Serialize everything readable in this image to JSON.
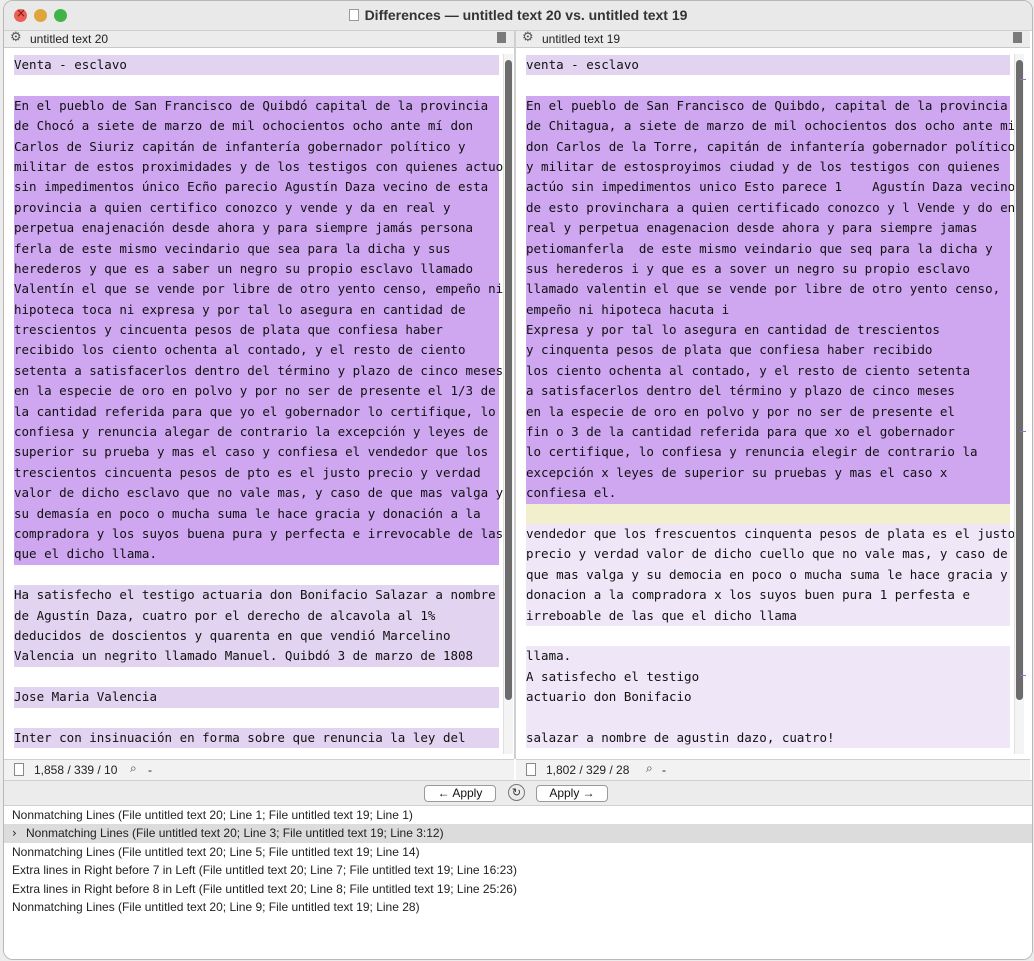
{
  "window": {
    "title": "Differences — untitled text 20 vs. untitled text 19"
  },
  "left": {
    "name": "untitled text 20",
    "status": "1,858 / 339 / 10",
    "search": "-",
    "lines": [
      {
        "t": "Venta - esclavo",
        "c": "l"
      },
      {
        "t": "",
        "c": ""
      },
      {
        "t": "En el pueblo de San Francisco de Quibdó capital de la provincia",
        "c": "p"
      },
      {
        "t": "de Chocó a siete de marzo de mil ochocientos ocho ante mí don",
        "c": "p"
      },
      {
        "t": "Carlos de Siuriz capitán de infantería gobernador político y",
        "c": "p"
      },
      {
        "t": "militar de estos proximidades y de los testigos con quienes actuo",
        "c": "p"
      },
      {
        "t": "sin impedimentos único Eсño parecio Agustín Daza vecino de esta",
        "c": "p"
      },
      {
        "t": "provincia a quien certifico conozco y vende y da en real y",
        "c": "p"
      },
      {
        "t": "perpetua enajenación desde ahora y para siempre jamás persona",
        "c": "p"
      },
      {
        "t": "ferla de este mismo vecindario que sea para la dicha y sus",
        "c": "p"
      },
      {
        "t": "herederos y que es a saber un negro su propio esclavo llamado",
        "c": "p"
      },
      {
        "t": "Valentín el que se vende por libre de otro yento censo, empeño ni",
        "c": "p"
      },
      {
        "t": "hipoteca toca ni expresa y por tal lo asegura en cantidad de",
        "c": "p"
      },
      {
        "t": "trescientos y cincuenta pesos de plata que confiesa haber",
        "c": "p"
      },
      {
        "t": "recibido los ciento ochenta al contado, y el resto de ciento",
        "c": "p"
      },
      {
        "t": "setenta a satisfacerlos dentro del término y plazo de cinco meses",
        "c": "p"
      },
      {
        "t": "en la especie de oro en polvo y por no ser de presente el 1/3 de",
        "c": "p"
      },
      {
        "t": "la cantidad referida para que yo el gobernador lo certifique, lo",
        "c": "p"
      },
      {
        "t": "confiesa y renuncia alegar de contrario la excepción y leyes de",
        "c": "p"
      },
      {
        "t": "superior su prueba y mas el caso y confiesa el vendedor que los",
        "c": "p"
      },
      {
        "t": "trescientos cincuenta pesos de pto es el justo precio y verdad",
        "c": "p"
      },
      {
        "t": "valor de dicho esclavo que no vale mas, y caso de que mas valga y",
        "c": "p"
      },
      {
        "t": "su demasía en poco o mucha suma le hace gracia y donación a la",
        "c": "p"
      },
      {
        "t": "compradora y los suyos buena pura y perfecta e irrevocable de las",
        "c": "p"
      },
      {
        "t": "que el dicho llama.",
        "c": "p"
      },
      {
        "t": "",
        "c": ""
      },
      {
        "t": "Ha satisfecho el testigo actuaria don Bonifacio Salazar a nombre",
        "c": "l"
      },
      {
        "t": "de Agustín Daza, cuatro por el derecho de alcavola al 1%",
        "c": "l"
      },
      {
        "t": "deducidos de doscientos y quarenta en que vendió Marcelino",
        "c": "l"
      },
      {
        "t": "Valencia un negrito llamado Manuel. Quibdó 3 de marzo de 1808",
        "c": "l"
      },
      {
        "t": "",
        "c": ""
      },
      {
        "t": "Jose Maria Valencia",
        "c": "l"
      },
      {
        "t": "",
        "c": ""
      },
      {
        "t": "Inter con insinuación en forma sobre que renuncia la ley del",
        "c": "l"
      }
    ]
  },
  "right": {
    "name": "untitled text 19",
    "status": "1,802 / 329 / 28",
    "search": "-",
    "lines": [
      {
        "t": "venta - esclavo",
        "c": "l"
      },
      {
        "t": "",
        "c": ""
      },
      {
        "t": "En el pueblo de San Francisco de Quibdo, capital de la provincia",
        "c": "p"
      },
      {
        "t": "de Chitagua, a siete de marzo de mil ochocientos dos ocho ante mi",
        "c": "p"
      },
      {
        "t": "don Carlos de la Torre, capitán de infantería gobernador político",
        "c": "p"
      },
      {
        "t": "y militar de estosproyimos ciudad y de los testigos con quienes",
        "c": "p"
      },
      {
        "t": "actúo sin impedimentos unico Esto parece 1    Agustín Daza vecino",
        "c": "p"
      },
      {
        "t": "de esto provinchara a quien certificado conozco y l Vende y do en",
        "c": "p"
      },
      {
        "t": "real y perpetua enagenacion desde ahora y para siempre jamas",
        "c": "p"
      },
      {
        "t": "petiomanferla  de este mismo veindario que seq para la dicha y",
        "c": "p"
      },
      {
        "t": "sus herederos i y que es a sover un negro su propio esclavo",
        "c": "p"
      },
      {
        "t": "llamado valentin el que se vende por libre de otro yento censo,",
        "c": "p"
      },
      {
        "t": "empeño ni hipoteca hacuta i",
        "c": "p"
      },
      {
        "t": "Expresa y por tal lo asegura en cantidad de trescientos",
        "c": "p"
      },
      {
        "t": "y cinquenta pesos de plata que confiesa haber recibido",
        "c": "p"
      },
      {
        "t": "los ciento ochenta al contado, y el resto de ciento setenta",
        "c": "p"
      },
      {
        "t": "a satisfacerlos dentro del término y plazo de cinco meses",
        "c": "p"
      },
      {
        "t": "en la especie de oro en polvo y por no ser de presente el",
        "c": "p"
      },
      {
        "t": "fin o 3 de la cantidad referida para que xo el gobernador",
        "c": "p"
      },
      {
        "t": "lo certifique, lo confiesa y renuncia elegir de contrario la",
        "c": "p"
      },
      {
        "t": "excepción x leyes de superior su pruebas y mas el caso x",
        "c": "p"
      },
      {
        "t": "confiesa el.",
        "c": "p"
      },
      {
        "t": "",
        "c": "y"
      },
      {
        "t": "vendedor que los frescuentos cinquenta pesos de plata es el justo",
        "c": "e"
      },
      {
        "t": "precio y verdad valor de dicho cuello que no vale mas, y caso de",
        "c": "e"
      },
      {
        "t": "que mas valga y su democia en poco o mucha suma le hace gracia y",
        "c": "e"
      },
      {
        "t": "donacion a la compradora x los suyos buen pura 1 perfesta e",
        "c": "e"
      },
      {
        "t": "irreboable de las que el dicho llama",
        "c": "e"
      },
      {
        "t": "",
        "c": ""
      },
      {
        "t": "llama.",
        "c": "e"
      },
      {
        "t": "A satisfecho el testigo",
        "c": "e"
      },
      {
        "t": "actuario don Bonifacio",
        "c": "e"
      },
      {
        "t": "",
        "c": "e"
      },
      {
        "t": "salazar a nombre de agustin dazo, cuatro!",
        "c": "e"
      }
    ]
  },
  "toolbar": {
    "apply_left": "← Apply",
    "apply_right": "Apply →",
    "refresh_icon": "↻"
  },
  "differences": [
    "Nonmatching Lines (File untitled text 20; Line 1; File untitled text 19; Line 1)",
    "Nonmatching Lines (File untitled text 20; Line 3; File untitled text 19; Line 3:12)",
    "Nonmatching Lines (File untitled text 20; Line 5; File untitled text 19; Line 14)",
    "Extra lines in Right before 7 in Left (File untitled text 20; Line 7; File untitled text 19; Line 16:23)",
    "Extra lines in Right before 8 in Left (File untitled text 20; Line 8; File untitled text 19; Line 25:26)",
    "Nonmatching Lines (File untitled text 20; Line 9; File untitled text 19; Line 28)"
  ],
  "selected_difference": 1,
  "colors": {
    "line_diff": "#e2d3f1",
    "char_diff": "#cfa6f0",
    "insert": "#f2efce"
  }
}
